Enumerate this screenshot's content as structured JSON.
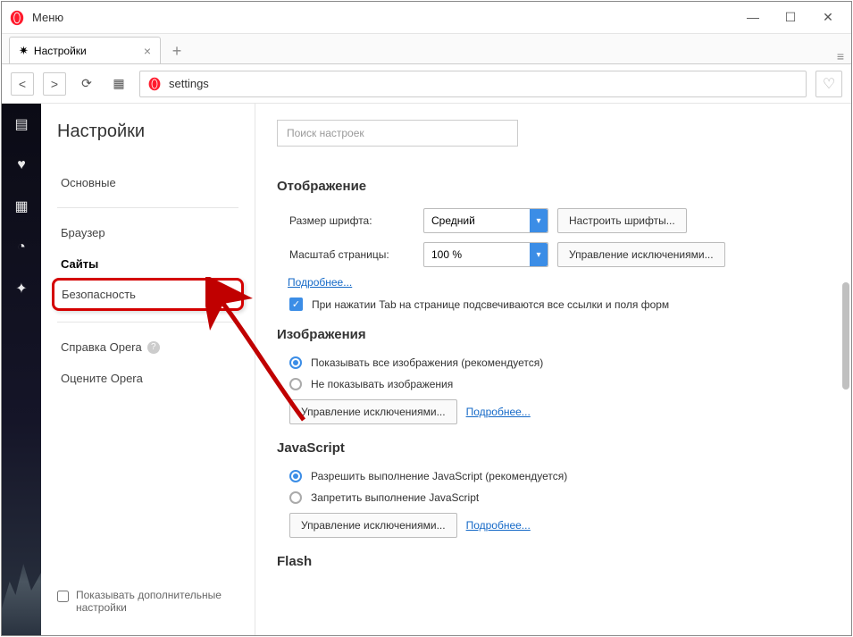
{
  "window": {
    "menu_label": "Меню"
  },
  "tab": {
    "title": "Настройки"
  },
  "address_bar": {
    "url": "settings"
  },
  "sidebar": {
    "title": "Настройки",
    "items": [
      "Основные",
      "Браузер",
      "Сайты",
      "Безопасность"
    ],
    "help_items": [
      "Справка Opera",
      "Оцените Opera"
    ],
    "show_advanced_label": "Показывать дополнительные настройки"
  },
  "search": {
    "placeholder": "Поиск настроек"
  },
  "sections": {
    "display": {
      "title": "Отображение",
      "font_size_label": "Размер шрифта:",
      "font_size_value": "Средний",
      "font_button": "Настроить шрифты...",
      "zoom_label": "Масштаб страницы:",
      "zoom_value": "100 %",
      "zoom_button": "Управление исключениями...",
      "more_link": "Подробнее...",
      "tab_check_label": "При нажатии Tab на странице подсвечиваются все ссылки и поля форм"
    },
    "images": {
      "title": "Изображения",
      "opt_show": "Показывать все изображения (рекомендуется)",
      "opt_hide": "Не показывать изображения",
      "manage_btn": "Управление исключениями...",
      "more_link": "Подробнее..."
    },
    "javascript": {
      "title": "JavaScript",
      "opt_allow": "Разрешить выполнение JavaScript (рекомендуется)",
      "opt_block": "Запретить выполнение JavaScript",
      "manage_btn": "Управление исключениями...",
      "more_link": "Подробнее..."
    },
    "flash": {
      "title": "Flash"
    }
  }
}
